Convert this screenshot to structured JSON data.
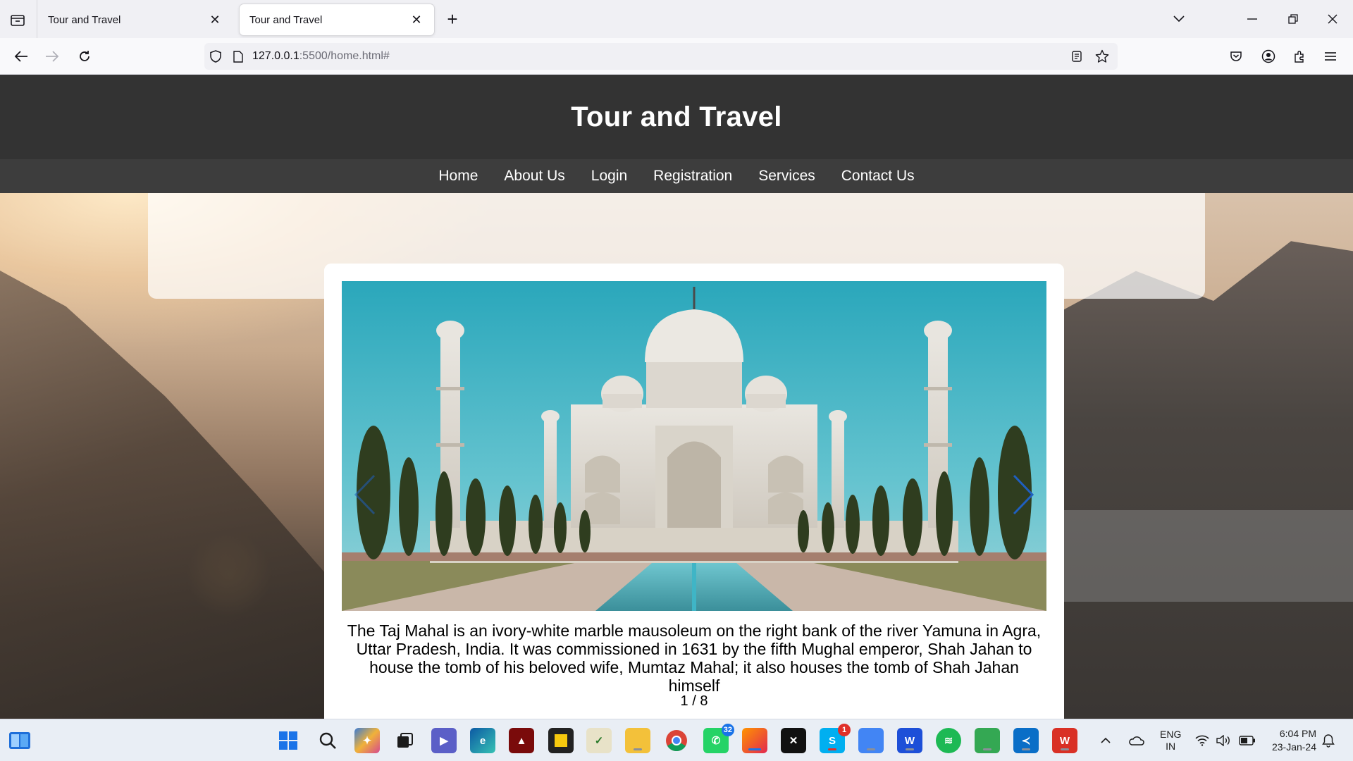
{
  "browser": {
    "tabs": [
      {
        "title": "Tour and Travel",
        "active": false
      },
      {
        "title": "Tour and Travel",
        "active": true
      }
    ],
    "url_host": "127.0.0.1",
    "url_rest": ":5500/home.html#"
  },
  "site": {
    "title": "Tour and Travel",
    "nav": [
      "Home",
      "About Us",
      "Login",
      "Registration",
      "Services",
      "Contact Us"
    ]
  },
  "slider": {
    "caption": "The Taj Mahal is an ivory-white marble mausoleum on the right bank of the river Yamuna in Agra, Uttar Pradesh, India. It was commissioned in 1631 by the fifth Mughal emperor, Shah Jahan to house the tomb of his beloved wife, Mumtaz Mahal; it also houses the tomb of Shah Jahan himself",
    "counter": "1 / 8",
    "current": 1,
    "total": 8,
    "arrow_color": "#1f5fbf"
  },
  "taskbar": {
    "badges": {
      "whatsapp": "32",
      "skype": "1"
    },
    "lang_top": "ENG",
    "lang_bottom": "IN",
    "time": "6:04 PM",
    "date": "23-Jan-24"
  }
}
